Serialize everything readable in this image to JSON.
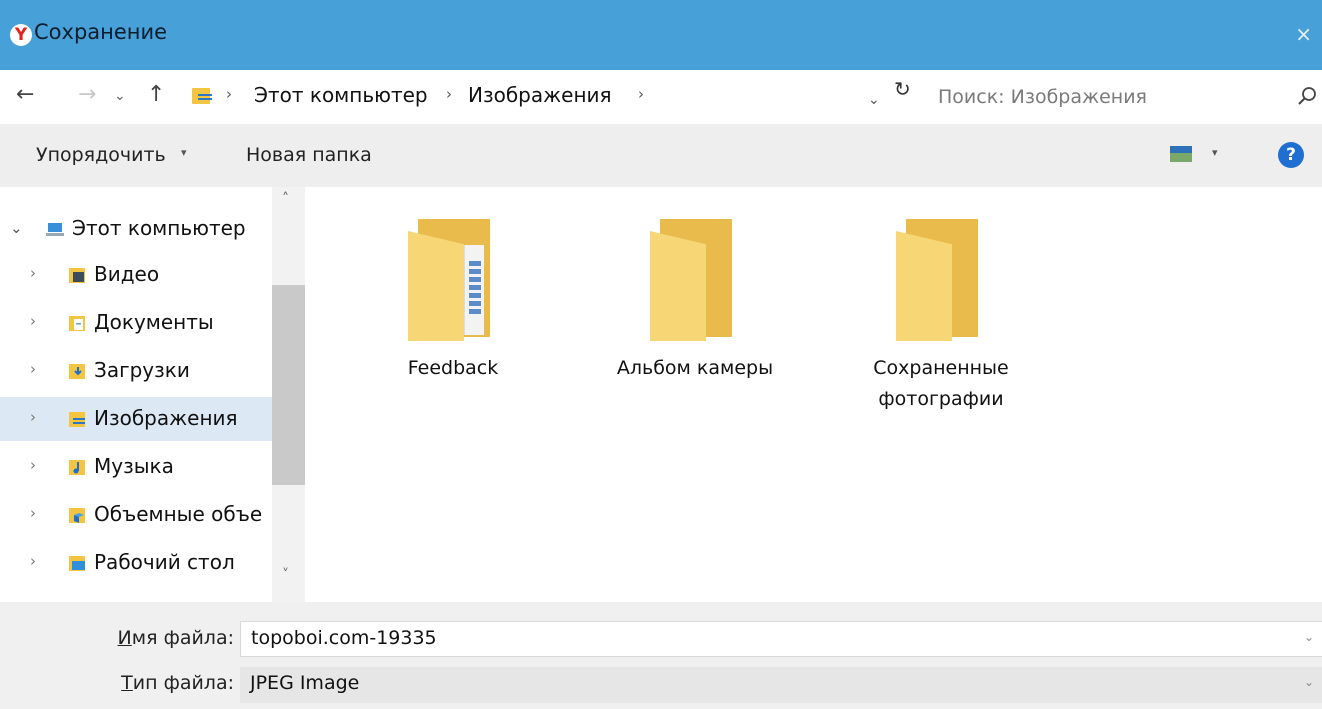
{
  "window": {
    "title": "Сохранение",
    "close_label": "×"
  },
  "address": {
    "back": "←",
    "forward": "→",
    "recent": "⌄",
    "up": "↑",
    "crumbs": [
      "Этот компьютер",
      "Изображения"
    ],
    "separator": "›",
    "dropdown": "⌄",
    "refresh": "↻",
    "search_placeholder": "Поиск: Изображения"
  },
  "toolbar": {
    "organize_label": "Упорядочить",
    "organize_caret": "▾",
    "new_folder_label": "Новая папка",
    "view_caret": "▾",
    "help_label": "?"
  },
  "navigation": {
    "scroll_up": "˄",
    "scroll_down": "˅",
    "items": [
      {
        "label": "Этот компьютер",
        "icon": "computer-icon",
        "expanded": true
      },
      {
        "label": "Видео",
        "icon": "video-folder-icon"
      },
      {
        "label": "Документы",
        "icon": "documents-folder-icon"
      },
      {
        "label": "Загрузки",
        "icon": "downloads-folder-icon"
      },
      {
        "label": "Изображения",
        "icon": "pictures-folder-icon",
        "selected": true
      },
      {
        "label": "Музыка",
        "icon": "music-folder-icon"
      },
      {
        "label": "Объемные объе",
        "icon": "3d-objects-folder-icon"
      },
      {
        "label": "Рабочий стол",
        "icon": "desktop-folder-icon"
      }
    ],
    "chevron_collapsed": "›",
    "chevron_expanded": "⌄"
  },
  "folders": [
    {
      "name": "Feedback",
      "icon": "folder-with-document-icon"
    },
    {
      "name": "Альбом камеры",
      "icon": "folder-icon"
    },
    {
      "name": "Сохраненные фотографии",
      "icon": "folder-icon"
    }
  ],
  "fields": {
    "filename_label_first": "И",
    "filename_label_rest": "мя файла:",
    "filename_value": "topoboi.com-19335",
    "filetype_label_first": "Т",
    "filetype_label_rest": "ип файла:",
    "filetype_value": "JPEG Image",
    "dropdown_caret": "⌄"
  },
  "colors": {
    "titlebar": "#48a0d8",
    "selected_row": "#dde8f5",
    "folder": "#f6d675",
    "help_button": "#1f6fd0"
  }
}
